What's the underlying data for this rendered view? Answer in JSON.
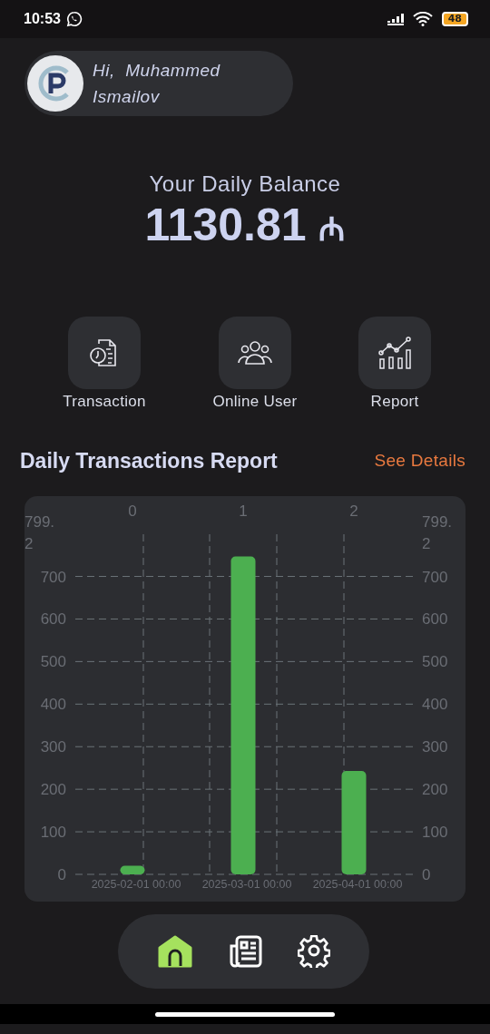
{
  "status_bar": {
    "time": "10:53",
    "battery": "48"
  },
  "greeting": {
    "text": "Hi,  Muhammed Ismailov"
  },
  "balance": {
    "title": "Your Daily Balance",
    "amount": "1130.81",
    "currency": "₼"
  },
  "actions": [
    {
      "label": "Transaction",
      "kind": "transaction"
    },
    {
      "label": "Online User",
      "kind": "users"
    },
    {
      "label": "Report",
      "kind": "report"
    }
  ],
  "report": {
    "title": "Daily Transactions Report",
    "link": "See Details",
    "top_labels": [
      "0",
      "1",
      "2"
    ],
    "right_axis_labels": [
      "799.2",
      "700",
      "600",
      "500",
      "400",
      "300",
      "200",
      "100",
      "0"
    ],
    "chart_data": {
      "type": "bar",
      "categories": [
        "2025-02-01 00:00",
        "2025-03-01 00:00",
        "2025-04-01 00:00"
      ],
      "series": [
        {
          "color": "#4caf50",
          "values": [
            20,
            747,
            243
          ]
        }
      ],
      "grid": true,
      "ylim": [
        0,
        799.2
      ],
      "yticks": [
        {
          "value": 0,
          "label": "0"
        },
        {
          "value": 100,
          "label": "100"
        },
        {
          "value": 200,
          "label": "200"
        },
        {
          "value": 300,
          "label": "300"
        },
        {
          "value": 400,
          "label": "400"
        },
        {
          "value": 500,
          "label": "500"
        },
        {
          "value": 600,
          "label": "600"
        },
        {
          "value": 700,
          "label": "700"
        },
        {
          "value": 799.2,
          "label": "799.2"
        }
      ]
    }
  },
  "nav": [
    {
      "kind": "home",
      "selected": true
    },
    {
      "kind": "news",
      "selected": false
    },
    {
      "kind": "settings",
      "selected": false
    }
  ]
}
